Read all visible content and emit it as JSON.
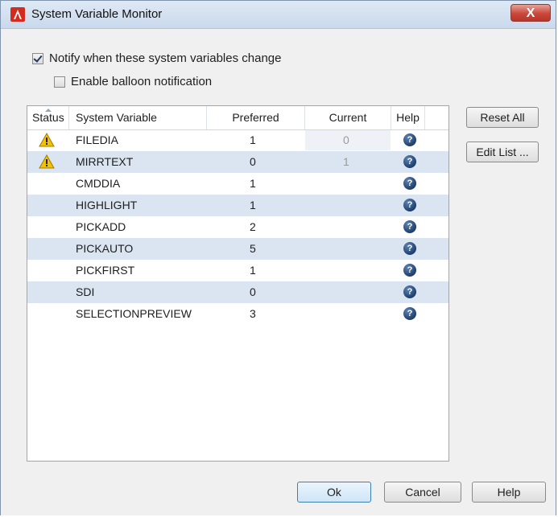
{
  "window": {
    "title": "System Variable Monitor",
    "close_label": "X"
  },
  "options": {
    "notify_label": "Notify when these system variables change",
    "notify_checked": true,
    "balloon_label": "Enable balloon notification",
    "balloon_checked": false
  },
  "table": {
    "columns": {
      "status": "Status",
      "variable": "System Variable",
      "preferred": "Preferred",
      "current": "Current",
      "help": "Help"
    },
    "rows": [
      {
        "warning": true,
        "variable": "FILEDIA",
        "preferred": "1",
        "current": "0",
        "help": "?"
      },
      {
        "warning": true,
        "variable": "MIRRTEXT",
        "preferred": "0",
        "current": "1",
        "help": "?"
      },
      {
        "warning": false,
        "variable": "CMDDIA",
        "preferred": "1",
        "current": "",
        "help": "?"
      },
      {
        "warning": false,
        "variable": "HIGHLIGHT",
        "preferred": "1",
        "current": "",
        "help": "?"
      },
      {
        "warning": false,
        "variable": "PICKADD",
        "preferred": "2",
        "current": "",
        "help": "?"
      },
      {
        "warning": false,
        "variable": "PICKAUTO",
        "preferred": "5",
        "current": "",
        "help": "?"
      },
      {
        "warning": false,
        "variable": "PICKFIRST",
        "preferred": "1",
        "current": "",
        "help": "?"
      },
      {
        "warning": false,
        "variable": "SDI",
        "preferred": "0",
        "current": "",
        "help": "?"
      },
      {
        "warning": false,
        "variable": "SELECTIONPREVIEW",
        "preferred": "3",
        "current": "",
        "help": "?"
      }
    ]
  },
  "buttons": {
    "reset_all": "Reset All",
    "edit_list": "Edit List ...",
    "ok": "Ok",
    "cancel": "Cancel",
    "help": "Help"
  },
  "colors": {
    "alt_row": "#dbe5f1",
    "warning": "#f2c200",
    "help_icon": "#1f3f6d",
    "close_button": "#c9483b"
  }
}
